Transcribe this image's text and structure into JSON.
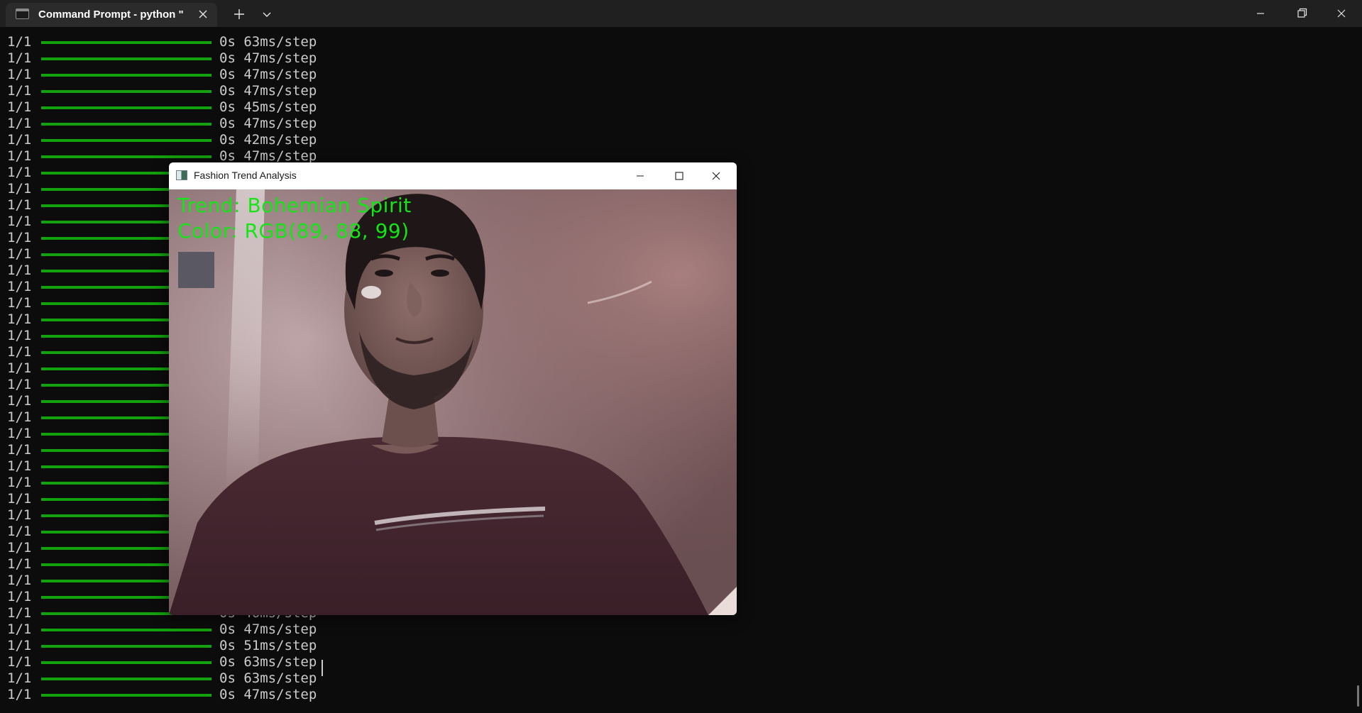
{
  "terminal": {
    "tab_title": "Command Prompt - python \"",
    "tab_icon": "terminal-icon",
    "accent_color": "#13a10e",
    "text_color": "#cccccc",
    "lines": [
      {
        "epoch": "1/1",
        "timing": "0s 63ms/step"
      },
      {
        "epoch": "1/1",
        "timing": "0s 47ms/step"
      },
      {
        "epoch": "1/1",
        "timing": "0s 47ms/step"
      },
      {
        "epoch": "1/1",
        "timing": "0s 47ms/step"
      },
      {
        "epoch": "1/1",
        "timing": "0s 45ms/step"
      },
      {
        "epoch": "1/1",
        "timing": "0s 47ms/step"
      },
      {
        "epoch": "1/1",
        "timing": "0s 42ms/step"
      },
      {
        "epoch": "1/1",
        "timing": "0s 47ms/step"
      },
      {
        "epoch": "1/1",
        "timing": ""
      },
      {
        "epoch": "1/1",
        "timing": ""
      },
      {
        "epoch": "1/1",
        "timing": ""
      },
      {
        "epoch": "1/1",
        "timing": ""
      },
      {
        "epoch": "1/1",
        "timing": ""
      },
      {
        "epoch": "1/1",
        "timing": ""
      },
      {
        "epoch": "1/1",
        "timing": ""
      },
      {
        "epoch": "1/1",
        "timing": ""
      },
      {
        "epoch": "1/1",
        "timing": ""
      },
      {
        "epoch": "1/1",
        "timing": ""
      },
      {
        "epoch": "1/1",
        "timing": ""
      },
      {
        "epoch": "1/1",
        "timing": ""
      },
      {
        "epoch": "1/1",
        "timing": ""
      },
      {
        "epoch": "1/1",
        "timing": ""
      },
      {
        "epoch": "1/1",
        "timing": ""
      },
      {
        "epoch": "1/1",
        "timing": ""
      },
      {
        "epoch": "1/1",
        "timing": ""
      },
      {
        "epoch": "1/1",
        "timing": ""
      },
      {
        "epoch": "1/1",
        "timing": ""
      },
      {
        "epoch": "1/1",
        "timing": ""
      },
      {
        "epoch": "1/1",
        "timing": ""
      },
      {
        "epoch": "1/1",
        "timing": ""
      },
      {
        "epoch": "1/1",
        "timing": ""
      },
      {
        "epoch": "1/1",
        "timing": ""
      },
      {
        "epoch": "1/1",
        "timing": ""
      },
      {
        "epoch": "1/1",
        "timing": ""
      },
      {
        "epoch": "1/1",
        "timing": ""
      },
      {
        "epoch": "1/1",
        "timing": "0s 46ms/step"
      },
      {
        "epoch": "1/1",
        "timing": "0s 47ms/step"
      },
      {
        "epoch": "1/1",
        "timing": "0s 51ms/step"
      },
      {
        "epoch": "1/1",
        "timing": "0s 63ms/step"
      },
      {
        "epoch": "1/1",
        "timing": "0s 63ms/step"
      },
      {
        "epoch": "1/1",
        "timing": "0s 47ms/step"
      }
    ]
  },
  "cv_window": {
    "title": "Fashion Trend Analysis",
    "trend_text": "Trend: Bohemian Spirit",
    "color_text": "Color: RGB(89, 88, 99)",
    "swatch_color": "#595863",
    "overlay_color": "#14e514"
  }
}
